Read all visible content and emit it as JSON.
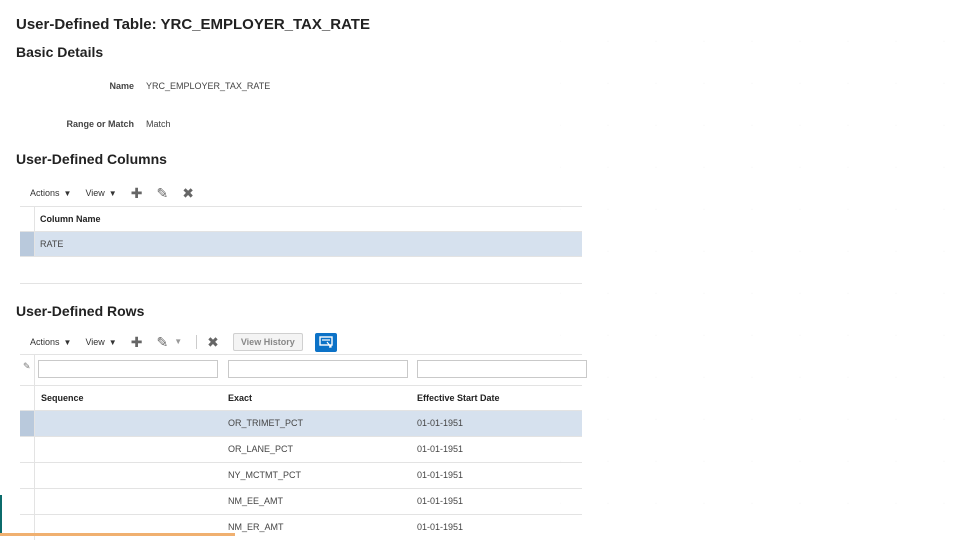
{
  "page": {
    "title": "User-Defined Table: YRC_EMPLOYER_TAX_RATE"
  },
  "basic_details": {
    "section_title": "Basic Details",
    "name_label": "Name",
    "name_value": "YRC_EMPLOYER_TAX_RATE",
    "range_label": "Range or Match",
    "range_value": "Match"
  },
  "columns_section": {
    "section_title": "User-Defined Columns",
    "toolbar": {
      "actions_label": "Actions",
      "view_label": "View"
    },
    "header": {
      "column_name": "Column Name"
    },
    "rows": [
      {
        "column_name": "RATE"
      }
    ]
  },
  "rows_section": {
    "section_title": "User-Defined Rows",
    "toolbar": {
      "actions_label": "Actions",
      "view_label": "View",
      "view_history_label": "View History"
    },
    "header": {
      "sequence": "Sequence",
      "exact": "Exact",
      "effective_start_date": "Effective Start Date"
    },
    "rows": [
      {
        "sequence": "",
        "exact": "OR_TRIMET_PCT",
        "effective_start_date": "01-01-1951"
      },
      {
        "sequence": "",
        "exact": "OR_LANE_PCT",
        "effective_start_date": "01-01-1951"
      },
      {
        "sequence": "",
        "exact": "NY_MCTMT_PCT",
        "effective_start_date": "01-01-1951"
      },
      {
        "sequence": "",
        "exact": "NM_EE_AMT",
        "effective_start_date": "01-01-1951"
      },
      {
        "sequence": "",
        "exact": "NM_ER_AMT",
        "effective_start_date": "01-01-1951"
      }
    ]
  },
  "icons": {
    "add": "plus-icon",
    "edit": "pencil-icon",
    "delete": "x-icon",
    "detach": "detach-icon"
  },
  "colors": {
    "selected_row": "#d6e1ee",
    "accent_blue": "#0c72c7"
  }
}
